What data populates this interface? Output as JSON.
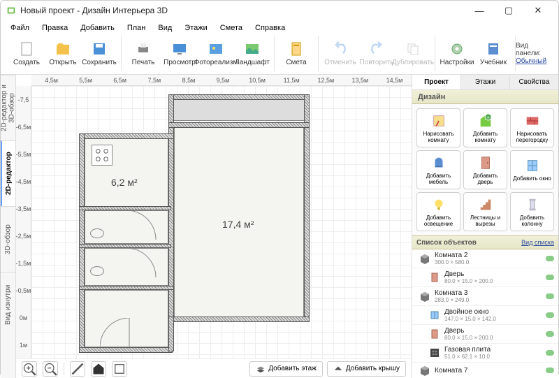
{
  "window": {
    "title": "Новый проект - Дизайн Интерьера 3D"
  },
  "menu": [
    "Файл",
    "Правка",
    "Добавить",
    "План",
    "Вид",
    "Этажи",
    "Смета",
    "Справка"
  ],
  "toolbar": {
    "create": "Создать",
    "open": "Открыть",
    "save": "Сохранить",
    "print": "Печать",
    "view": "Просмотр",
    "photo": "Фотореализм",
    "landscape": "Ландшафт",
    "estimate": "Смета",
    "undo": "Отменить",
    "redo": "Повторить",
    "duplicate": "Дублировать",
    "settings": "Настройки",
    "tutorial": "Учебник"
  },
  "viewpanel": {
    "label": "Вид панели:",
    "mode": "Обычный"
  },
  "side_tabs": [
    "2D-редактор и 3D-обзор",
    "2D-редактор",
    "3D-обзор",
    "Вид изнутри"
  ],
  "rulers": {
    "top": [
      "4,5м",
      "5,5м",
      "6,5м",
      "7,5м",
      "8,5м",
      "9,5м",
      "10,5м",
      "11,5м",
      "12,5м",
      "13,5м",
      "14,5м"
    ],
    "left": [
      "-7,5",
      "-6,5м",
      "-5,5м",
      "-4,5м",
      "-3,5м",
      "-2,5м",
      "-1,5м",
      "-0,5м",
      "0м",
      "1м"
    ]
  },
  "rooms": {
    "r1": "6,2 м²",
    "r2": "17,4 м²"
  },
  "canvas_footer": {
    "add_floor": "Добавить этаж",
    "add_roof": "Добавить крышу"
  },
  "right_tabs": [
    "Проект",
    "Этажи",
    "Свойства"
  ],
  "design_header": "Дизайн",
  "design_buttons": [
    "Нарисовать комнату",
    "Добавить комнату",
    "Нарисовать перегородку",
    "Добавить мебель",
    "Добавить дверь",
    "Добавить окно",
    "Добавить освещение",
    "Лестницы и вырезы",
    "Добавить колонну"
  ],
  "objlist": {
    "header": "Список объектов",
    "viewmode": "Вид списка",
    "items": [
      {
        "name": "Комната 2",
        "dim": "300.0 × 580.0",
        "child": false,
        "icon": "room"
      },
      {
        "name": "Дверь",
        "dim": "80.0 × 15.0 × 200.0",
        "child": true,
        "icon": "door"
      },
      {
        "name": "Комната 3",
        "dim": "283.0 × 249.0",
        "child": false,
        "icon": "room"
      },
      {
        "name": "Двойное окно",
        "dim": "147.0 × 15.0 × 142.0",
        "child": true,
        "icon": "window"
      },
      {
        "name": "Дверь",
        "dim": "80.0 × 15.0 × 200.0",
        "child": true,
        "icon": "door"
      },
      {
        "name": "Газовая плита",
        "dim": "51.0 × 62.1 × 10.0",
        "child": true,
        "icon": "stove"
      },
      {
        "name": "Комната 7",
        "dim": "",
        "child": false,
        "icon": "room"
      }
    ]
  }
}
